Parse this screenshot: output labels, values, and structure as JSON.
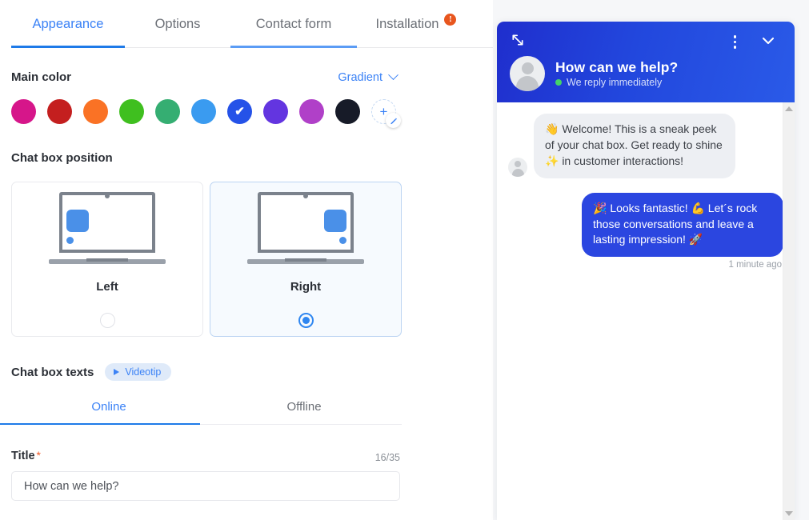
{
  "tabs": [
    {
      "label": "Appearance",
      "state": "active"
    },
    {
      "label": "Options",
      "state": "normal"
    },
    {
      "label": "Contact form",
      "state": "hovered"
    },
    {
      "label": "Installation",
      "state": "normal",
      "badge": "!"
    }
  ],
  "main_color": {
    "label": "Main color",
    "gradient_label": "Gradient",
    "selected_index": 6,
    "swatches": [
      {
        "name": "pink",
        "color": "#d6168a"
      },
      {
        "name": "red",
        "color": "#c41f1f"
      },
      {
        "name": "orange",
        "color": "#fa7225"
      },
      {
        "name": "green",
        "color": "#3fbf1f"
      },
      {
        "name": "teal-green",
        "color": "#35ae72"
      },
      {
        "name": "light-blue",
        "color": "#3a9bf0"
      },
      {
        "name": "blue",
        "color": "#2552e8"
      },
      {
        "name": "purple",
        "color": "#6335e0"
      },
      {
        "name": "magenta",
        "color": "#b040c8"
      },
      {
        "name": "black",
        "color": "#171b28"
      }
    ],
    "add_label": "+",
    "check_glyph": "✔"
  },
  "position": {
    "label": "Chat box position",
    "options": [
      {
        "label": "Left",
        "side": "left",
        "selected": false
      },
      {
        "label": "Right",
        "side": "right",
        "selected": true
      }
    ]
  },
  "texts": {
    "label": "Chat box texts",
    "videotip_label": "Videotip",
    "subtabs": [
      {
        "label": "Online",
        "active": true
      },
      {
        "label": "Offline",
        "active": false
      }
    ],
    "title_field": {
      "label": "Title",
      "required_mark": "*",
      "counter": "16/35",
      "value": "How can we help?",
      "placeholder": "How can we help?"
    }
  },
  "widget": {
    "title": "How can we help?",
    "status": "We reply immediately",
    "messages": [
      {
        "direction": "in",
        "text": "👋 Welcome! This is a sneak peek of your chat box. Get ready to shine ✨ in customer interactions!"
      },
      {
        "direction": "out",
        "text": "🎉 Looks fantastic! 💪 Let´s rock those conversations and leave a lasting impression! 🚀",
        "time": "1 minute ago"
      }
    ]
  },
  "colors": {
    "accent": "#3b82f6",
    "active_underline": "#1e7ae8",
    "hover_underline": "#5b9cf5",
    "badge": "#e8561e",
    "widget_header_from": "#1f2ecd",
    "widget_header_to": "#2a5ae8",
    "bubble_out": "#2b46e0",
    "bubble_in": "#edeff3",
    "online_dot": "#44d467"
  }
}
